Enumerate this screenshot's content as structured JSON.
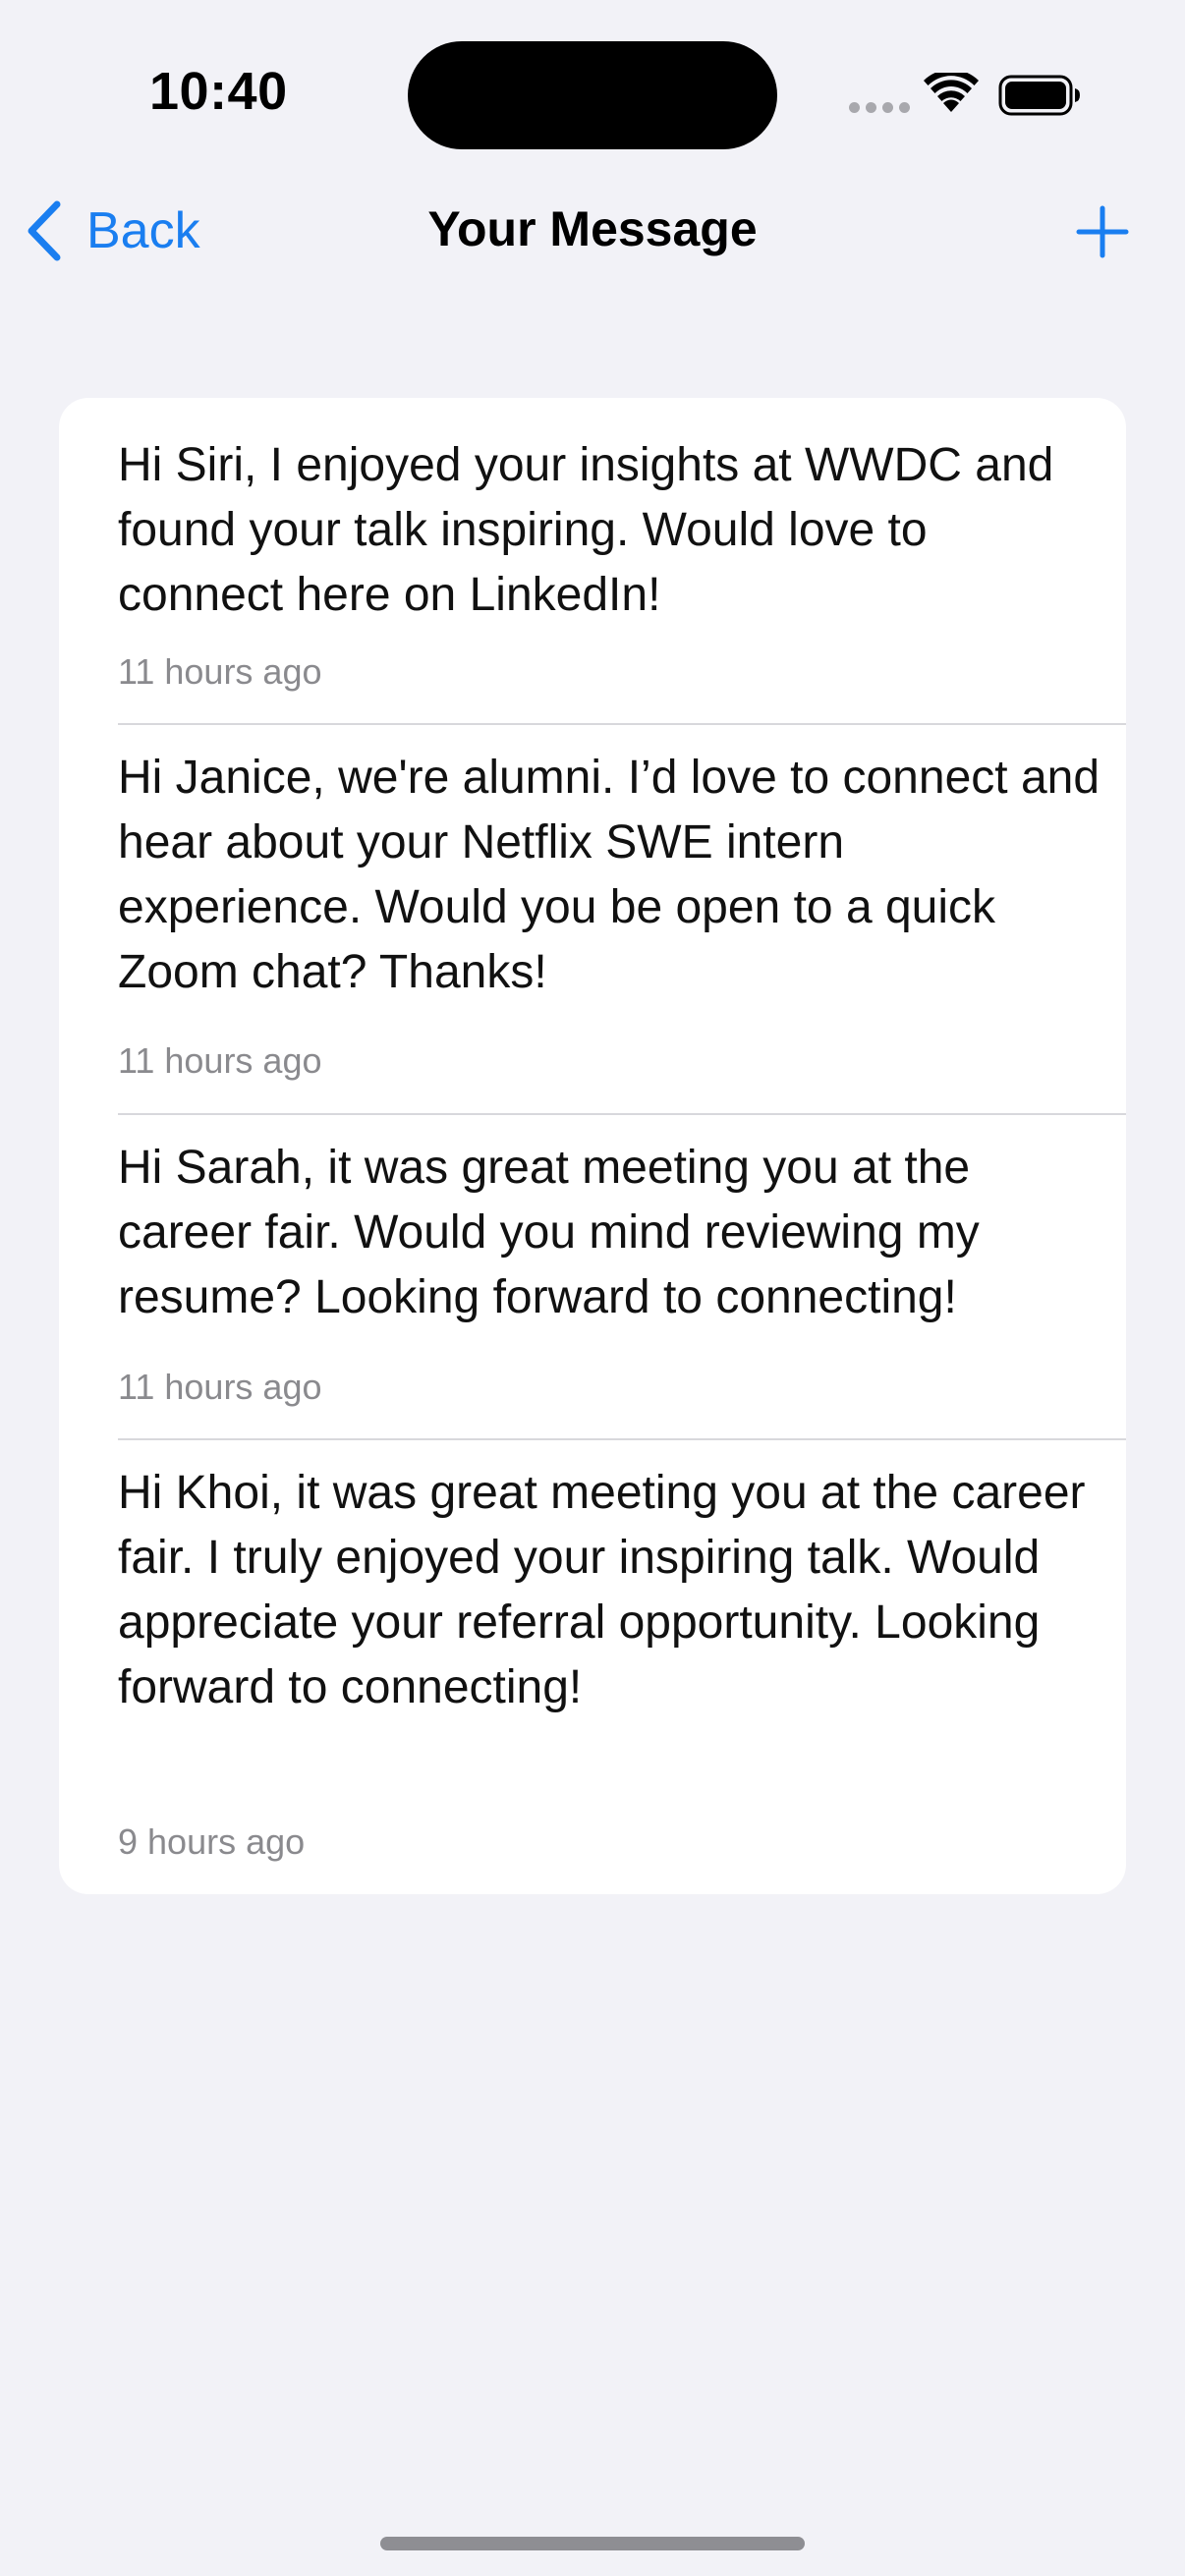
{
  "status_bar": {
    "time": "10:40"
  },
  "nav": {
    "back_label": "Back",
    "title": "Your Message",
    "add_icon": "plus-icon",
    "back_icon": "chevron-left-icon",
    "accent_color": "#1a7ef0"
  },
  "messages": [
    {
      "text": "Hi Siri, I enjoyed your insights at WWDC and found your talk inspiring. Would love to connect here on LinkedIn!",
      "time": "11 hours ago"
    },
    {
      "text": "Hi Janice, we're alumni. I’d love to connect and hear about your Netflix SWE intern experience. Would you be open to a quick Zoom chat? Thanks!",
      "time": "11 hours ago"
    },
    {
      "text": "Hi Sarah, it was great meeting you at the career fair. Would you mind reviewing my resume? Looking forward to connecting!",
      "time": "11 hours ago"
    },
    {
      "text": "Hi Khoi, it was great meeting you at the career fair. I truly enjoyed your inspiring talk. Would appreciate your referral opportunity. Looking forward to connecting!",
      "time": "9 hours ago"
    }
  ]
}
